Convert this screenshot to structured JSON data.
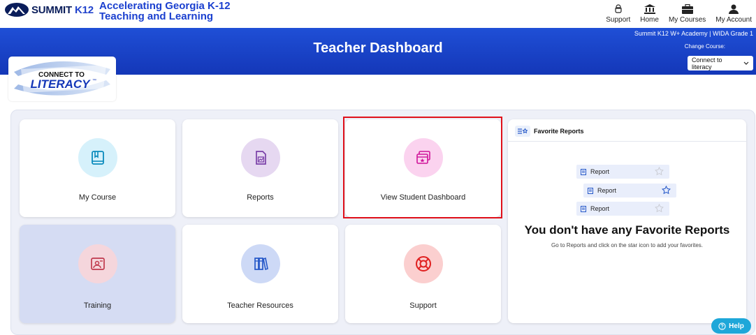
{
  "header": {
    "brand": "SUMMIT",
    "brand_suffix": "K12",
    "tagline_line1": "Accelerating Georgia K-12",
    "tagline_line2": "Teaching and Learning",
    "nav": [
      {
        "label": "Support",
        "icon": "support-bell-icon"
      },
      {
        "label": "Home",
        "icon": "home-building-icon"
      },
      {
        "label": "My Courses",
        "icon": "briefcase-icon"
      },
      {
        "label": "My Account",
        "icon": "user-icon"
      }
    ]
  },
  "banner": {
    "title": "Teacher Dashboard",
    "course_name": "Summit K12 W+ Academy | WIDA Grade 1",
    "change_course_label": "Change Course:",
    "course_select_value": "Connect to literacy"
  },
  "literacy_logo": {
    "line1": "CONNECT TO",
    "line2": "LITERACY",
    "tm": "™"
  },
  "tiles": [
    {
      "label": "My Course",
      "icon": "book-icon",
      "icon_bg": "#d6f1fb",
      "icon_color": "#0b8bbd"
    },
    {
      "label": "Reports",
      "icon": "report-chart-icon",
      "icon_bg": "#e6d8f1",
      "icon_color": "#7a3fa8"
    },
    {
      "label": "View Student Dashboard",
      "icon": "student-dashboard-icon",
      "icon_bg": "#fbd3ef",
      "icon_color": "#d0159a"
    },
    {
      "label": "Training",
      "icon": "training-board-icon",
      "icon_bg": "#f5d6dc",
      "icon_color": "#c0394d"
    },
    {
      "label": "Teacher Resources",
      "icon": "books-icon",
      "icon_bg": "#cdd9f6",
      "icon_color": "#2457c8"
    },
    {
      "label": "Support",
      "icon": "lifebuoy-icon",
      "icon_bg": "#fbcfcf",
      "icon_color": "#e02020"
    }
  ],
  "favorites": {
    "title": "Favorite Reports",
    "sample_rows": [
      "Report",
      "Report",
      "Report"
    ],
    "empty_title": "You don't have any Favorite Reports",
    "empty_subtitle": "Go to Reports and click on the star icon to add your favorites."
  },
  "help_button": "Help",
  "colors": {
    "banner_blue": "#1a44c9",
    "highlight_red": "#e0101a",
    "help_blue": "#1ea7d9"
  }
}
